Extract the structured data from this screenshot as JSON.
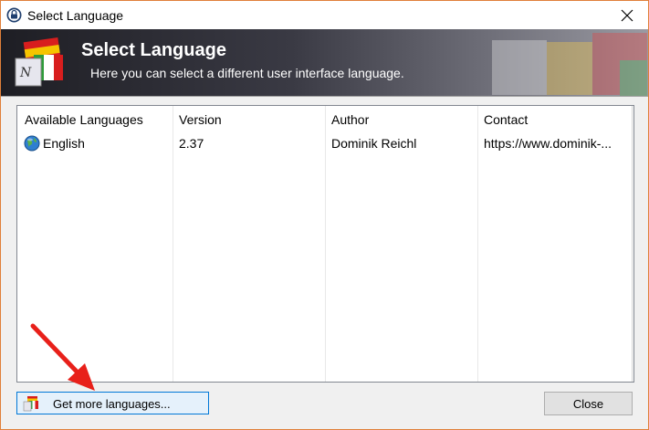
{
  "window": {
    "title": "Select Language",
    "close_glyph": "✕",
    "icon": "keepass-lock-icon"
  },
  "banner": {
    "title": "Select Language",
    "subtitle": "Here you can select a different user interface language.",
    "icon": "language-flags-icon"
  },
  "list": {
    "columns": [
      "Available Languages",
      "Version",
      "Author",
      "Contact"
    ],
    "rows": [
      {
        "language": "English",
        "version": "2.37",
        "author": "Dominik Reichl",
        "contact": "https://www.dominik-..."
      }
    ]
  },
  "buttons": {
    "get_more": "Get more languages...",
    "close": "Close"
  },
  "colors": {
    "accent_border": "#0078d7",
    "annotation_arrow": "#e8201a",
    "window_border": "#e0803a"
  }
}
